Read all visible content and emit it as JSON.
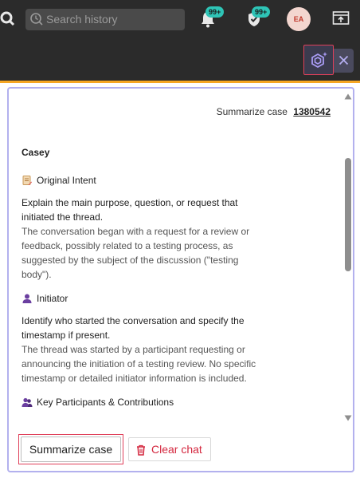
{
  "topbar": {
    "search_placeholder": "Search history",
    "notifications_badge": "99+",
    "tasks_badge": "99+",
    "avatar_initials": "EA"
  },
  "panel": {
    "header_label": "Summarize case",
    "case_number": "1380542",
    "author": "Casey",
    "sections": [
      {
        "icon": "scroll-icon",
        "title": "Original Intent",
        "prompt": "Explain the main purpose, question, or request that initiated the thread.",
        "answer": "The conversation began with a request for a review or feedback, possibly related to a testing process, as suggested by the subject of the discussion (\"testing body\")."
      },
      {
        "icon": "person-icon",
        "title": "Initiator",
        "prompt": "Identify who started the conversation and specify the timestamp if present.",
        "answer": "The thread was started by a participant requesting or announcing the initiation of a testing review. No specific timestamp or detailed initiator information is included."
      },
      {
        "icon": "people-icon",
        "title": "Key Participants & Contributions",
        "prompt": "",
        "answer": ""
      }
    ],
    "summarize_button": "Summarize case",
    "clear_button": "Clear chat"
  },
  "colors": {
    "topbar_bg": "#2b2b2b",
    "accent_orange": "#f5a623",
    "panel_border": "#b3b1ee",
    "highlight_red": "#e0405a",
    "danger": "#d4283f",
    "badge": "#2ec4b6"
  }
}
